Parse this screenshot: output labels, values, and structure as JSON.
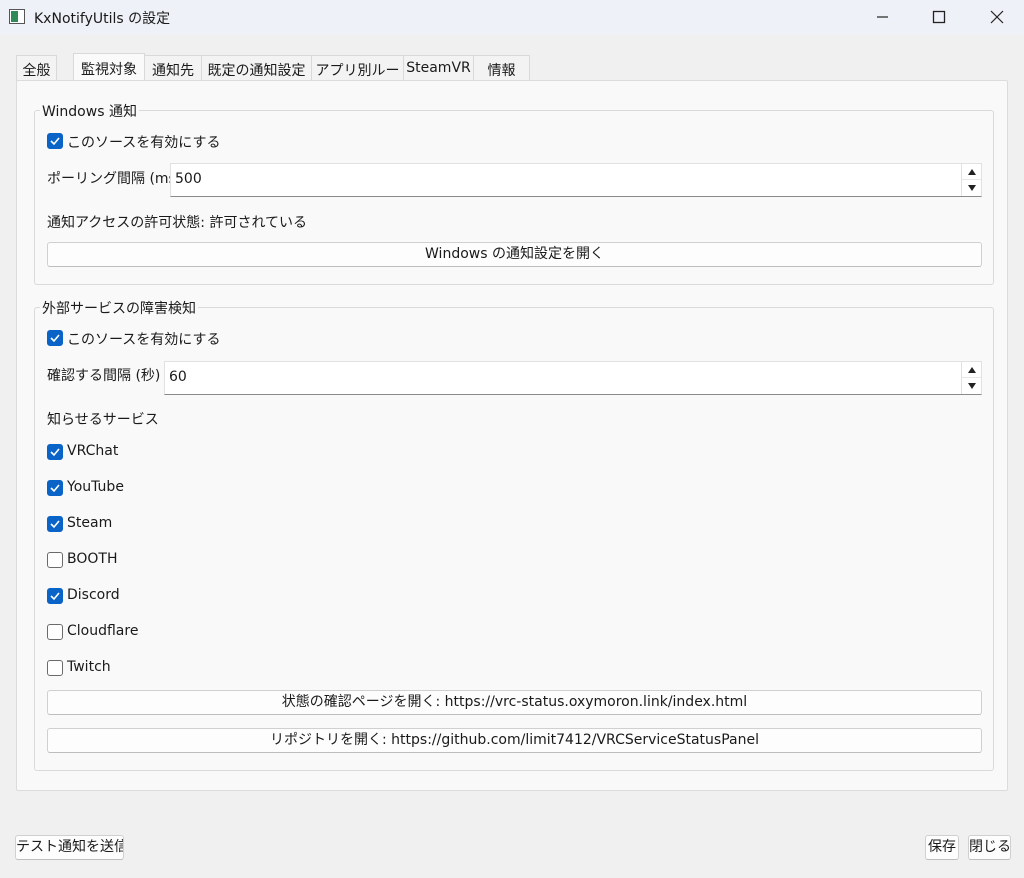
{
  "window": {
    "title": "KxNotifyUtils の設定",
    "controls": {
      "minimize_icon": "minimize-icon",
      "maximize_icon": "maximize-icon",
      "close_icon": "close-icon"
    }
  },
  "tabs": [
    {
      "label": "全般"
    },
    {
      "label": "監視対象",
      "active": true
    },
    {
      "label": "通知先"
    },
    {
      "label": "既定の通知設定"
    },
    {
      "label": "アプリ別ルール"
    },
    {
      "label": "SteamVR"
    },
    {
      "label": "情報"
    }
  ],
  "windows_group": {
    "title": "Windows 通知",
    "enable_label": "このソースを有効にする",
    "enabled": true,
    "polling_label": "ポーリング間隔 (ms)",
    "polling_value": "500",
    "access_status": "通知アクセスの許可状態: 許可されている",
    "open_settings_button": "Windows の通知設定を開く"
  },
  "external_group": {
    "title": "外部サービスの障害検知",
    "enable_label": "このソースを有効にする",
    "enabled": true,
    "interval_label": "確認する間隔 (秒)",
    "interval_value": "60",
    "services_label": "知らせるサービス",
    "services": [
      {
        "label": "VRChat",
        "checked": true
      },
      {
        "label": "YouTube",
        "checked": true
      },
      {
        "label": "Steam",
        "checked": true
      },
      {
        "label": "BOOTH",
        "checked": false
      },
      {
        "label": "Discord",
        "checked": true
      },
      {
        "label": "Cloudflare",
        "checked": false
      },
      {
        "label": "Twitch",
        "checked": false
      }
    ],
    "status_page_button": "状態の確認ページを開く: https://vrc-status.oxymoron.link/index.html",
    "repository_button": "リポジトリを開く: https://github.com/limit7412/VRCServiceStatusPanel"
  },
  "footer": {
    "send_test_button": "テスト通知を送信",
    "save_button": "保存",
    "close_button": "閉じる"
  },
  "colors": {
    "accent": "#0a64c8",
    "panel": "#f9f9f9",
    "background": "#f0f0f0"
  }
}
